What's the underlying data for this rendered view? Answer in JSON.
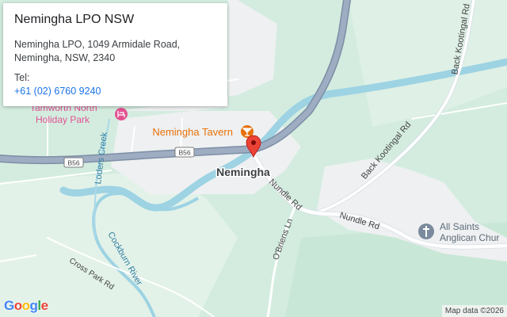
{
  "info": {
    "title": "Nemingha LPO NSW",
    "address_line1": "Nemingha LPO, 1049 Armidale Road,",
    "address_line2": "Nemingha, NSW, 2340",
    "tel_label": "Tel:",
    "tel": "+61 (02) 6760 9240"
  },
  "map": {
    "town": "Nemingha",
    "pois": {
      "tavern": "Nemingha Tavern",
      "holiday_park_1": "Tamworth North",
      "holiday_park_2": "Holiday Park",
      "church_1": "All Saints",
      "church_2": "Anglican Chur"
    },
    "roads": {
      "shield_1": "B56",
      "shield_2": "B56",
      "back_kootingal_1": "Back Kootingal Rd",
      "back_kootingal_2": "Back Kootingal Rd",
      "nundle_1": "Nundle Rd",
      "nundle_2": "Nundle Rd",
      "obriens": "O'Briens Ln",
      "cross_park": "Cross Park Rd"
    },
    "waters": {
      "loders": "Loders Creek",
      "cockburn": "Cockburn River"
    },
    "colors": {
      "land_green": "#ceeadb",
      "urban": "#f1f3f4",
      "water": "#9dd3e3",
      "highway": "#8e9fb6",
      "road": "#ffffff",
      "poi_orange": "#e8710a",
      "poi_pink": "#e25293",
      "pin_red": "#ea4335"
    }
  },
  "logo": {
    "g1": "G",
    "o1": "o",
    "o2": "o",
    "g2": "g",
    "l": "l",
    "e": "e",
    "colors": [
      "#4285f4",
      "#ea4335",
      "#fbbc04",
      "#4285f4",
      "#34a853",
      "#ea4335"
    ]
  },
  "attribution": "Map data ©2026"
}
